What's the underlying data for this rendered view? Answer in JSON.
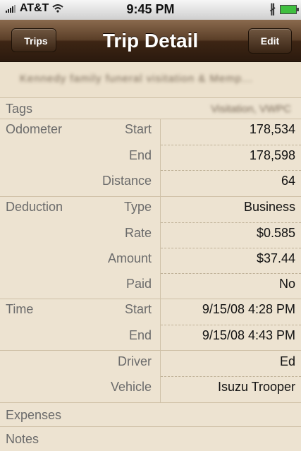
{
  "status": {
    "carrier": "AT&T",
    "time": "9:45 PM"
  },
  "nav": {
    "title": "Trip Detail",
    "back_label": "Trips",
    "edit_label": "Edit"
  },
  "trip_title": "Kennedy family funeral visitation & Memp...",
  "tags": {
    "label": "Tags",
    "value": "Visitation, VWPC"
  },
  "odometer": {
    "label": "Odometer",
    "start_label": "Start",
    "start_value": "178,534",
    "end_label": "End",
    "end_value": "178,598",
    "distance_label": "Distance",
    "distance_value": "64"
  },
  "deduction": {
    "label": "Deduction",
    "type_label": "Type",
    "type_value": "Business",
    "rate_label": "Rate",
    "rate_value": "$0.585",
    "amount_label": "Amount",
    "amount_value": "$37.44",
    "paid_label": "Paid",
    "paid_value": "No"
  },
  "time": {
    "label": "Time",
    "start_label": "Start",
    "start_value": "9/15/08 4:28 PM",
    "end_label": "End",
    "end_value": "9/15/08 4:43 PM"
  },
  "driver": {
    "label": "Driver",
    "value": "Ed"
  },
  "vehicle": {
    "label": "Vehicle",
    "value": "Isuzu Trooper"
  },
  "expenses_label": "Expenses",
  "notes_label": "Notes"
}
